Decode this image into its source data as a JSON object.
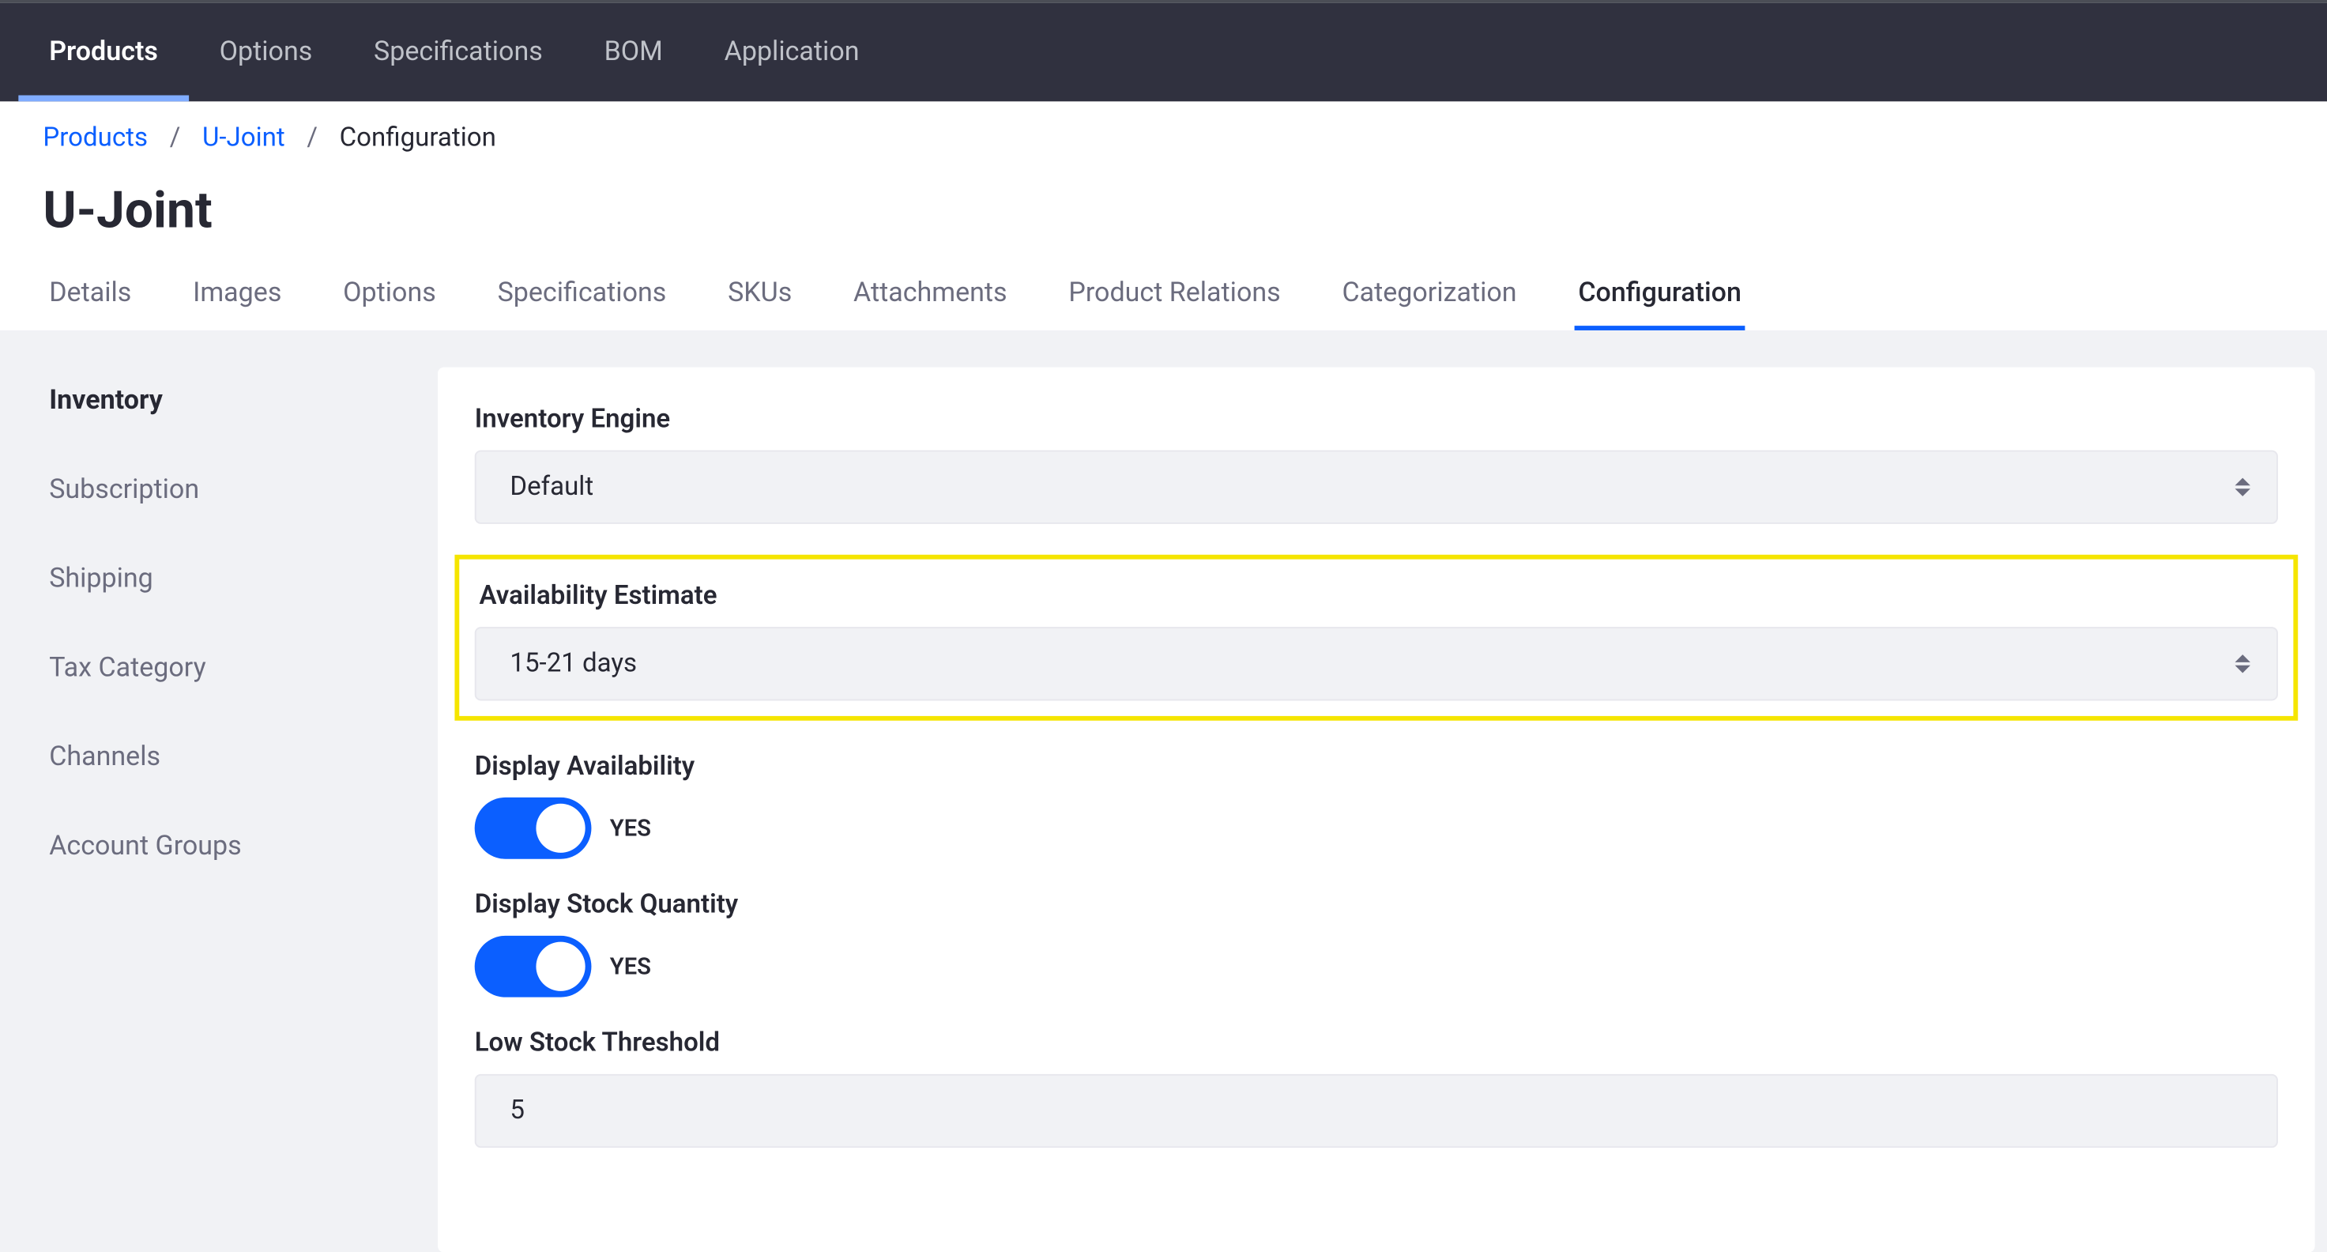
{
  "topnav": {
    "items": [
      {
        "label": "Products",
        "active": true
      },
      {
        "label": "Options",
        "active": false
      },
      {
        "label": "Specifications",
        "active": false
      },
      {
        "label": "BOM",
        "active": false
      },
      {
        "label": "Application",
        "active": false
      }
    ]
  },
  "breadcrumb": {
    "items": [
      {
        "label": "Products",
        "link": true
      },
      {
        "label": "U-Joint",
        "link": true
      },
      {
        "label": "Configuration",
        "link": false
      }
    ],
    "sep": "/"
  },
  "page_title": "U-Joint",
  "subtabs": {
    "items": [
      {
        "label": "Details",
        "active": false
      },
      {
        "label": "Images",
        "active": false
      },
      {
        "label": "Options",
        "active": false
      },
      {
        "label": "Specifications",
        "active": false
      },
      {
        "label": "SKUs",
        "active": false
      },
      {
        "label": "Attachments",
        "active": false
      },
      {
        "label": "Product Relations",
        "active": false
      },
      {
        "label": "Categorization",
        "active": false
      },
      {
        "label": "Configuration",
        "active": true
      }
    ]
  },
  "sidenav": {
    "items": [
      {
        "label": "Inventory",
        "active": true
      },
      {
        "label": "Subscription",
        "active": false
      },
      {
        "label": "Shipping",
        "active": false
      },
      {
        "label": "Tax Category",
        "active": false
      },
      {
        "label": "Channels",
        "active": false
      },
      {
        "label": "Account Groups",
        "active": false
      }
    ]
  },
  "form": {
    "inventory_engine": {
      "label": "Inventory Engine",
      "value": "Default"
    },
    "availability_estimate": {
      "label": "Availability Estimate",
      "value": "15-21 days"
    },
    "display_availability": {
      "label": "Display Availability",
      "state_label": "YES",
      "on": true
    },
    "display_stock_quantity": {
      "label": "Display Stock Quantity",
      "state_label": "YES",
      "on": true
    },
    "low_stock_threshold": {
      "label": "Low Stock Threshold",
      "value": "5"
    }
  }
}
